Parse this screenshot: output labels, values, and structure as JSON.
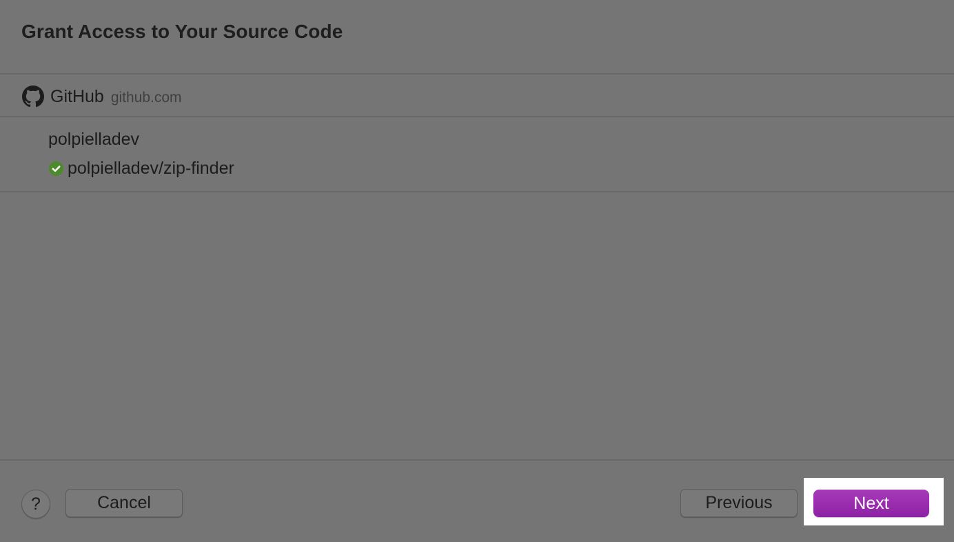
{
  "dialog": {
    "title": "Grant Access to Your Source Code"
  },
  "provider": {
    "icon": "github-icon",
    "name": "GitHub",
    "domain": "github.com"
  },
  "account": {
    "name": "polpielladev",
    "repositories": [
      {
        "name": "polpielladev/zip-finder",
        "status_icon": "checkmark-circle-icon",
        "status_color": "#4d8a2b"
      }
    ]
  },
  "footer": {
    "help_label": "?",
    "cancel_label": "Cancel",
    "previous_label": "Previous",
    "next_label": "Next"
  },
  "colors": {
    "accent": "#9b2eaf",
    "background": "#757575"
  }
}
